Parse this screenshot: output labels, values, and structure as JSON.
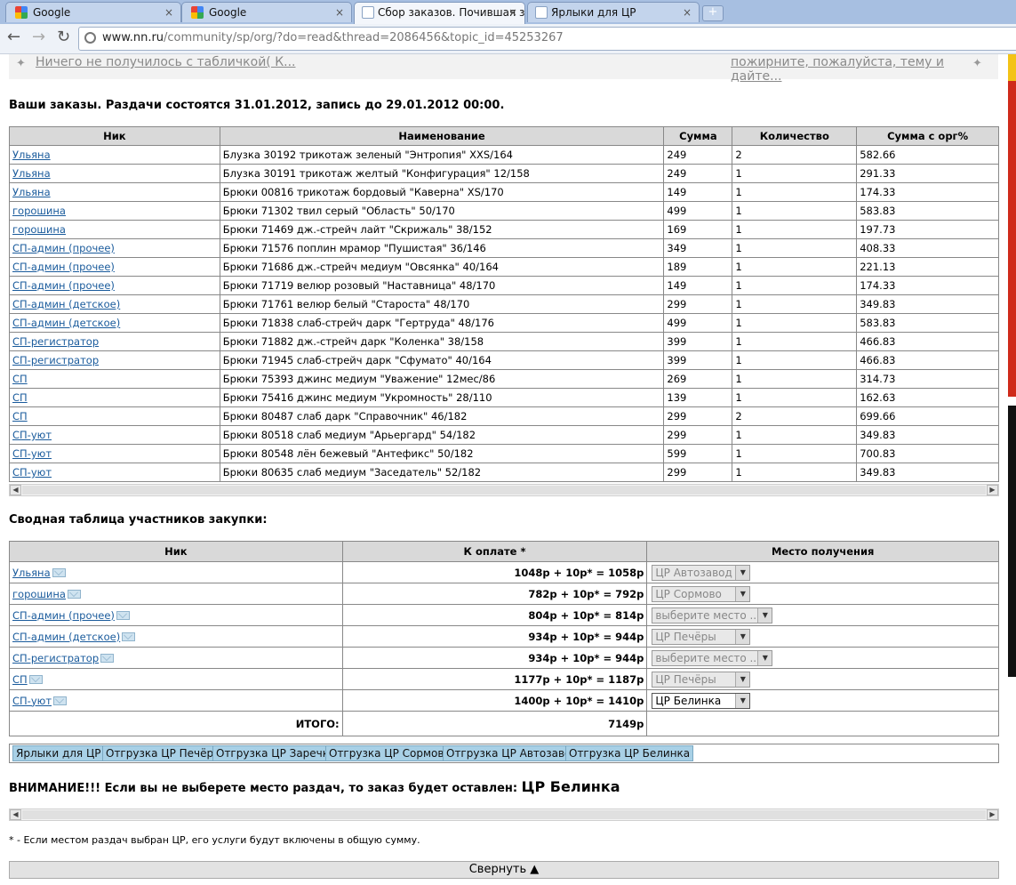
{
  "browser": {
    "tabs": [
      {
        "title": "Google",
        "icon": "google-favicon-icon"
      },
      {
        "title": "Google",
        "icon": "google-favicon-icon"
      },
      {
        "title": "Сбор заказов. Почившая зак",
        "icon": "page-favicon-icon",
        "active": true
      },
      {
        "title": "Ярлыки для ЦР",
        "icon": "page-favicon-icon"
      }
    ],
    "new_tab": "+",
    "close": "×",
    "url_host": "www.nn.ru",
    "url_path": "/community/sp/org/?do=read&thread=2086456&topic_id=45253267"
  },
  "topnav": {
    "prev": "Ничего не получилось с табличкой( К...",
    "next": "пожирните, пожалуйста, тему и дайте..."
  },
  "orders": {
    "heading": "Ваши заказы. Раздачи состоятся 31.01.2012, запись до 29.01.2012 00:00.",
    "columns": [
      "Ник",
      "Наименование",
      "Сумма",
      "Количество",
      "Сумма с орг%"
    ],
    "rows": [
      [
        "Ульяна",
        "Блузка 30192 трикотаж зеленый \"Энтропия\" XXS/164",
        "249",
        "2",
        "582.66"
      ],
      [
        "Ульяна",
        "Блузка 30191 трикотаж желтый \"Конфигурация\" 12/158",
        "249",
        "1",
        "291.33"
      ],
      [
        "Ульяна",
        "Брюки 00816 трикотаж бордовый \"Каверна\" XS/170",
        "149",
        "1",
        "174.33"
      ],
      [
        "горошина",
        "Брюки 71302 твил серый \"Область\" 50/170",
        "499",
        "1",
        "583.83"
      ],
      [
        "горошина",
        "Брюки 71469 дж.-стрейч лайт \"Скрижаль\" 38/152",
        "169",
        "1",
        "197.73"
      ],
      [
        "СП-админ (прочее)",
        "Брюки 71576 поплин мрамор \"Пушистая\" 36/146",
        "349",
        "1",
        "408.33"
      ],
      [
        "СП-админ (прочее)",
        "Брюки 71686 дж.-стрейч медиум \"Овсянка\" 40/164",
        "189",
        "1",
        "221.13"
      ],
      [
        "СП-админ (прочее)",
        "Брюки 71719 велюр розовый \"Наставница\" 48/170",
        "149",
        "1",
        "174.33"
      ],
      [
        "СП-админ (детское)",
        "Брюки 71761 велюр белый \"Староста\" 48/170",
        "299",
        "1",
        "349.83"
      ],
      [
        "СП-админ (детское)",
        "Брюки 71838 слаб-стрейч дарк \"Гертруда\" 48/176",
        "499",
        "1",
        "583.83"
      ],
      [
        "СП-регистратор",
        "Брюки 71882 дж.-стрейч дарк \"Коленка\" 38/158",
        "399",
        "1",
        "466.83"
      ],
      [
        "СП-регистратор",
        "Брюки 71945 слаб-стрейч дарк \"Сфумато\" 40/164",
        "399",
        "1",
        "466.83"
      ],
      [
        "СП",
        "Брюки 75393 джинс медиум \"Уважение\" 12мес/86",
        "269",
        "1",
        "314.73"
      ],
      [
        "СП",
        "Брюки 75416 джинс медиум \"Укромность\" 28/110",
        "139",
        "1",
        "162.63"
      ],
      [
        "СП",
        "Брюки 80487 слаб дарк \"Справочник\" 46/182",
        "299",
        "2",
        "699.66"
      ],
      [
        "СП-уют",
        "Брюки 80518 слаб медиум \"Арьергард\" 54/182",
        "299",
        "1",
        "349.83"
      ],
      [
        "СП-уют",
        "Брюки 80548 лён бежевый \"Антефикс\" 50/182",
        "599",
        "1",
        "700.83"
      ],
      [
        "СП-уют",
        "Брюки 80635 слаб медиум \"Заседатель\" 52/182",
        "299",
        "1",
        "349.83"
      ]
    ]
  },
  "summary": {
    "heading": "Сводная таблица участников закупки:",
    "columns": [
      "Ник",
      "К оплате *",
      "Место получения"
    ],
    "rows": [
      {
        "nick": "Ульяна",
        "pay": "1048р + 10р* = 1058р",
        "place": "ЦР Автозавод",
        "enabled": false
      },
      {
        "nick": "горошина",
        "pay": "782р + 10р* = 792р",
        "place": "ЦР Сормово",
        "enabled": false
      },
      {
        "nick": "СП-админ (прочее)",
        "pay": "804р + 10р* = 814р",
        "place": "выберите место ...",
        "enabled": false
      },
      {
        "nick": "СП-админ (детское)",
        "pay": "934р + 10р* = 944р",
        "place": "ЦР Печёры",
        "enabled": false
      },
      {
        "nick": "СП-регистратор",
        "pay": "934р + 10р* = 944р",
        "place": "выберите место ...",
        "enabled": false
      },
      {
        "nick": "СП",
        "pay": "1177р + 10р* = 1187р",
        "place": "ЦР Печёры",
        "enabled": false
      },
      {
        "nick": "СП-уют",
        "pay": "1400р + 10р* = 1410р",
        "place": "ЦР Белинка",
        "enabled": true
      }
    ],
    "total_label": "ИТОГО:",
    "total_value": "7149р"
  },
  "label_buttons": [
    "Ярлыки для ЦР",
    "Отгрузка ЦР Печёры",
    "Отгрузка ЦР Заречка",
    "Отгрузка ЦР Сормово",
    "Отгрузка ЦР Автозавод",
    "Отгрузка ЦР Белинка"
  ],
  "warning": {
    "text": "ВНИМАНИЕ!!! Если вы не выберете место раздач, то заказ будет оставлен:",
    "place": "ЦР Белинка"
  },
  "footnote": "* - Если местом раздач выбран ЦР, его услуги будут включены в общую сумму.",
  "collapse_label": "Свернуть ▲"
}
